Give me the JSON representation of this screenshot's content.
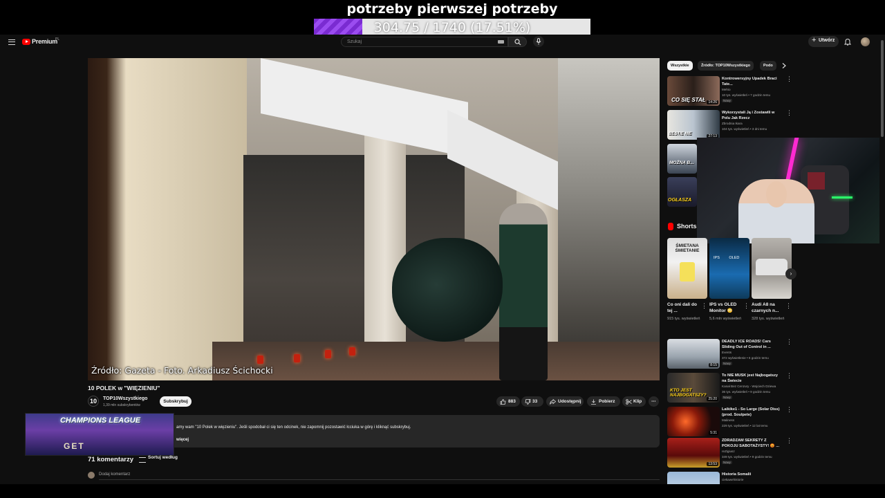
{
  "overlay": {
    "goal_title": "potrzeby pierwszej potrzeby",
    "goal_text": "304.75 / 1740 (17.51%)",
    "goal_fraction": 0.1751,
    "goal_color": "#8a3be0"
  },
  "header": {
    "logo": "Premium",
    "logo_sup": "PL",
    "search_placeholder": "Szukaj",
    "create_label": "Utwórz",
    "icons": [
      "menu-icon",
      "keyboard-icon",
      "search-icon",
      "microphone-icon",
      "bell-icon"
    ]
  },
  "video": {
    "caption": "Źródło: Gazeta - Foto. Arkadiusz Ścichocki",
    "title": "10 POLEK w \"WIĘZIENIU\"",
    "channel": {
      "avatar_text": "10",
      "name": "TOP10Wszystkiego",
      "subscribers": "1,39 mln subskrybentów",
      "subscribe_label": "Subskrybuj"
    },
    "actions": {
      "likes": "883",
      "dislikes": "33",
      "share": "Udostępnij",
      "download": "Pobierz",
      "clip": "Klip"
    },
    "description": "amy wam \"10 Polek w więzieniu\". Jeśli spodobał ci się ten odcinek, nie zapomnij pozostawić łcciuka w górę i kliknąć subskrybuj.",
    "description_more": "więcej"
  },
  "banner": {
    "title": "CHAMPIONS LEAGUE",
    "subtitle": "GET"
  },
  "comments": {
    "count": "71 komentarzy",
    "sort_label": "Sortuj według",
    "add_placeholder": "Dodaj komentarz"
  },
  "chips": [
    "Wszystkie",
    "Źródło: TOP10Wszystkiego",
    "Podo"
  ],
  "recommendations": [
    {
      "title": "Kontrowersyjny Upadek Braci Tate...",
      "channel": "Mehio",
      "meta": "10 tys. wyświetleń • 7 godzin temu",
      "badge": "Nowy",
      "duration": "14:26",
      "thumb_text": "CO SIĘ STAŁ"
    },
    {
      "title": "Wykorzystali Ją i Zostawili w Polu Jak Rzecz",
      "channel": "Zbrodnia Ikara",
      "meta": "104 tys. wyświetleń • 3 dni temu",
      "badge": "",
      "duration": "27:13",
      "thumb_text": "BESTIE NIE"
    },
    {
      "title": "",
      "channel": "",
      "meta": "",
      "badge": "",
      "duration": "",
      "thumb_text": "MOŻNA B..."
    },
    {
      "title": "",
      "channel": "",
      "meta": "",
      "badge": "",
      "duration": "",
      "thumb_text": "OGŁASZA"
    }
  ],
  "shorts_label": "Shorts",
  "shorts": [
    {
      "title": "Co oni dali do tej ...",
      "views": "915 tys. wyświetleń",
      "thumb_text": "ŚMIETANA ŚMIETANIE"
    },
    {
      "title": "IPS vs OLED Monitor 😳",
      "views": "5,6 mln wyświetleń",
      "thumb_text": "IPS OLED"
    },
    {
      "title": "Audi A8 na czarnych n...",
      "views": "328 tys. wyświetleń",
      "thumb_text": ""
    }
  ],
  "recommendations2": [
    {
      "title": "DEADLY ICE ROADS! Cars Sliding Out of Control in ...",
      "channel": "Events",
      "meta": "372 wyświetlenie • 6 godzin temu",
      "badge": "Nowy",
      "duration": "8:15",
      "thumb_text": ""
    },
    {
      "title": "To NIE MUSK jest Najbogatszy na Świecie",
      "channel": "Kanał Bez Cenzury - Wojciech Dziewa",
      "meta": "36 tys. wyświetleń • 9 godzin temu",
      "badge": "Nowy",
      "duration": "25:20",
      "thumb_text": "KTO JEST NAJBOGATSZY?"
    },
    {
      "title": "Laikike1 - So Large (Solar Diss) (prod. Soulpete)",
      "channel": "Maliness",
      "meta": "229 tys. wyświetleń • 12 lat temu",
      "badge": "",
      "duration": "5:31",
      "thumb_text": ""
    },
    {
      "title": "ZDRADZAM SEKRETY Z POKOJU SABOTAŻYSTY! 😡 ...",
      "channel": "reZigiusz",
      "meta": "349 tys. wyświetleń • 9 godzin temu",
      "badge": "Nowy",
      "duration": "13:53",
      "thumb_text": ""
    },
    {
      "title": "Historia Somalii",
      "channel": "ciekawehistorie",
      "meta": "",
      "badge": "",
      "duration": "",
      "thumb_text": ""
    }
  ]
}
